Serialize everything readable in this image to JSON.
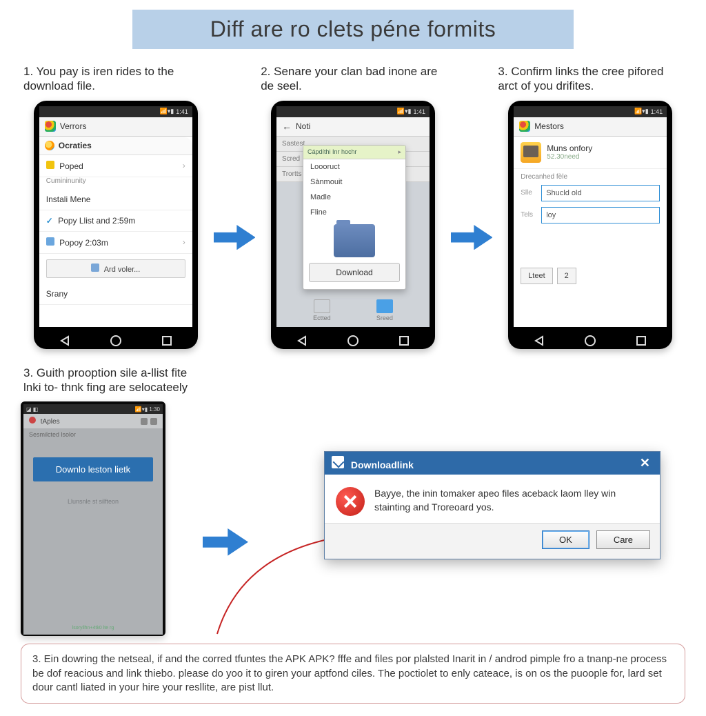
{
  "title": "Diff are ro clets péne formits",
  "steps": {
    "s1": "1.  You pay is iren rides to the download file.",
    "s2": "2.  Senare your clan bad inone are de seel.",
    "s3": "3.  Confirm links the cree pifored arct of you drifites.",
    "s4": "3. Guith prooption sile a-llist fite lnki to- thnk fing are selocateely"
  },
  "status_time": "1:41",
  "status_time_b": "1:41",
  "phone1": {
    "appbar": "Verrors",
    "header": "Ocraties",
    "items": {
      "a": "Poped",
      "a_sub": "Cumininunity",
      "b": "Instali Mene",
      "c": "Popy Llist and 2:59m",
      "d": "Popoy 2:03m",
      "btn": "Ard voler...",
      "e": "Srany"
    }
  },
  "phone2": {
    "rows": {
      "a": "Sastest",
      "b": "Scred",
      "c": "Trortts"
    },
    "popup": {
      "header": "Cápdíthi Inr hochr",
      "o1": "Loooruct",
      "o2": "Sànmouit",
      "o3": "Madle",
      "o4": "Fline",
      "btn": "Download"
    },
    "bottom": {
      "a": "Ectted",
      "b": "Sreed"
    }
  },
  "phone3": {
    "appbar": "Mestors",
    "name": "Muns onfory",
    "sub": "52.30need",
    "section": "Drecanhed fèle",
    "l1": "Slle",
    "v1": "Shucld old",
    "l2": "Tels",
    "v2": "loy",
    "b1": "Lteet",
    "b2": "2"
  },
  "phone4": {
    "tbar": "tAples",
    "lbl": "Sesmilcted lsolor",
    "btn": "Downlo leston lietk",
    "sub": "Llunsnle st silfteon",
    "tiny": "lsoryllhn+4tk0 lte rg"
  },
  "dialog": {
    "title": "Downloadlink",
    "msg": "Bayye, the inin tomaker apeo files aceback laom lley win stainting and Troreoard yos.",
    "ok": "OK",
    "care": "Care"
  },
  "footer": "3.  Ein dowring the netseal, if and the corred tfuntes the APK APK? fffe and files por plalsted Inarit in / androd pimple fro a tnanp-ne process be dof reacious and link thiebo. please do yoo it to giren your aptfond ciles. The poctiolet to enly cateace, is on os the puoople for, lard set dour cantl liated in your hire your resllite, are pist llut."
}
